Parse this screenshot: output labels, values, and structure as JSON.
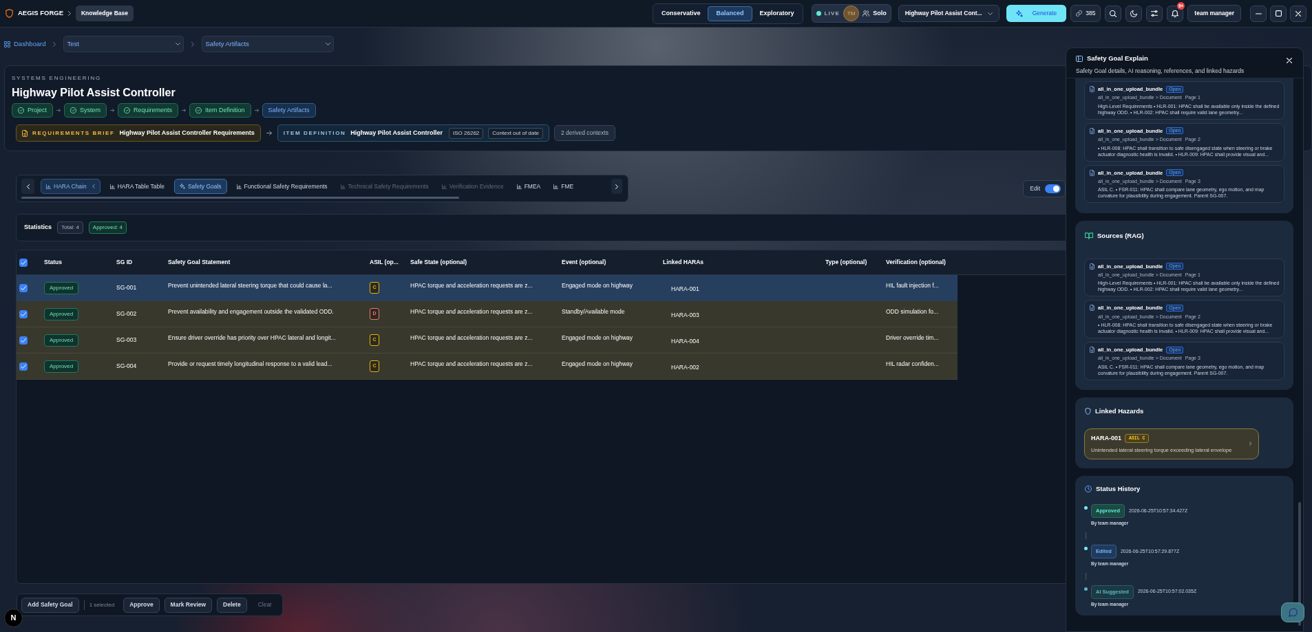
{
  "header": {
    "app_name": "AEGIS FORGE",
    "section": "Knowledge Base",
    "modes": [
      {
        "label": "Conservative",
        "selected": false
      },
      {
        "label": "Balanced",
        "selected": true
      },
      {
        "label": "Exploratory",
        "selected": false
      }
    ],
    "live": {
      "label": "LIVE",
      "avatar": "TM",
      "presence": "Solo"
    },
    "project": "Highway Pilot Assist Cont...",
    "generate": "Generate",
    "credits": "385",
    "notifications": "9+",
    "user": "team manager"
  },
  "breadcrumb": {
    "home": "Dashboard",
    "selects": [
      "Test",
      "Safety Artifacts"
    ]
  },
  "context_card": {
    "eyebrow": "SYSTEMS ENGINEERING",
    "title": "Highway Pilot Assist Controller",
    "steps": [
      {
        "label": "Project",
        "done": true
      },
      {
        "label": "System",
        "done": true
      },
      {
        "label": "Requirements",
        "done": true
      },
      {
        "label": "Item Definition",
        "done": true
      },
      {
        "label": "Safety Artifacts",
        "done": false
      }
    ],
    "brief": {
      "label": "REQUIREMENTS BRIEF",
      "value": "Highway Pilot Assist Controller Requirements"
    },
    "item_definition": {
      "label": "ITEM DEFINITION",
      "value": "Highway Pilot Assist Controller",
      "tags": [
        "ISO 26262",
        "Context out of date"
      ]
    },
    "derived": "2 derived contexts"
  },
  "tabs": [
    {
      "label": "HARA Chain",
      "kind": "group",
      "selected": false,
      "disabled": false
    },
    {
      "label": "HARA Table Table",
      "kind": "tab",
      "selected": false,
      "disabled": false
    },
    {
      "label": "Safety Goals",
      "kind": "ai",
      "selected": true,
      "disabled": false
    },
    {
      "label": "Functional Safety Requirements",
      "kind": "tab",
      "selected": false,
      "disabled": false
    },
    {
      "label": "Technical Safety Requirements",
      "kind": "tab",
      "selected": false,
      "disabled": true
    },
    {
      "label": "Verification Evidence",
      "kind": "tab",
      "selected": false,
      "disabled": true
    },
    {
      "label": "FMEA",
      "kind": "tab",
      "selected": false,
      "disabled": false
    },
    {
      "label": "FME",
      "kind": "tab",
      "selected": false,
      "disabled": false
    }
  ],
  "edit_toggle": {
    "label": "Edit",
    "on": true
  },
  "statistics": {
    "label": "Statistics",
    "chips": [
      {
        "label": "Total: 4",
        "kind": "total"
      },
      {
        "label": "Approved: 4",
        "kind": "approved"
      }
    ]
  },
  "table": {
    "all_checked": true,
    "columns": [
      "Status",
      "SG ID",
      "Safety Goal Statement",
      "ASIL (op...",
      "Safe State (optional)",
      "Event (optional)",
      "Linked HARAs",
      "Type (optional)",
      "Verification (optional)"
    ],
    "rows": [
      {
        "checked": true,
        "selected": true,
        "status": "Approved",
        "sg_id": "SG-001",
        "statement": "Prevent unintended lateral steering torque that could cause la...",
        "asil": {
          "label": "C",
          "color": "#eab308"
        },
        "safe_state": "HPAC torque and acceleration requests are z...",
        "event": "Engaged mode on highway",
        "linked_hara": "HARA-001",
        "verification": "HIL fault injection f..."
      },
      {
        "checked": true,
        "selected": false,
        "status": "Approved",
        "sg_id": "SG-002",
        "statement": "Prevent availability and engagement outside the validated ODD.",
        "asil": {
          "label": "D",
          "color": "#f87171"
        },
        "safe_state": "HPAC torque and acceleration requests are z...",
        "event": "Standby/Available mode",
        "linked_hara": "HARA-003",
        "verification": "ODD simulation fo..."
      },
      {
        "checked": true,
        "selected": false,
        "status": "Approved",
        "sg_id": "SG-003",
        "statement": "Ensure driver override has priority over HPAC lateral and longit...",
        "asil": {
          "label": "C",
          "color": "#eab308"
        },
        "safe_state": "HPAC torque and acceleration requests are z...",
        "event": "Engaged mode on highway",
        "linked_hara": "HARA-004",
        "verification": "Driver override tim..."
      },
      {
        "checked": true,
        "selected": false,
        "status": "Approved",
        "sg_id": "SG-004",
        "statement": "Provide or request timely longitudinal response to a valid lead...",
        "asil": {
          "label": "C",
          "color": "#eab308"
        },
        "safe_state": "HPAC torque and acceleration requests are z...",
        "event": "Engaged mode on highway",
        "linked_hara": "HARA-002",
        "verification": "HIL radar confiden..."
      }
    ]
  },
  "bulk_bar": {
    "add": "Add Safety Goal",
    "selection": "1 selected",
    "actions": [
      {
        "label": "Approve",
        "kind": "outline"
      },
      {
        "label": "Mark Review",
        "kind": "outline"
      },
      {
        "label": "Delete",
        "kind": "outline"
      },
      {
        "label": "Clear",
        "kind": "ghost"
      }
    ]
  },
  "dev_badge": "N",
  "explain_panel": {
    "title": "Safety Goal Explain",
    "subtitle": "Safety Goal details, AI reasoning, references, and linked hazards",
    "references": [
      {
        "name": "all_in_one_upload_bundle",
        "action": "Open",
        "path": "all_in_one_upload_bundle > Document",
        "page": "Page 1",
        "snippet": "High-Level Requirements • HLR-001: HPAC shall be available only inside the defined highway ODD. • HLR-002: HPAC shall require valid lane geometry..."
      },
      {
        "name": "all_in_one_upload_bundle",
        "action": "Open",
        "path": "all_in_one_upload_bundle > Document",
        "page": "Page 2",
        "snippet": "• HLR-008: HPAC shall transition to safe disengaged state when steering or brake actuator diagnostic health is invalid. • HLR-009: HPAC shall provide visual and..."
      },
      {
        "name": "all_in_one_upload_bundle",
        "action": "Open",
        "path": "all_in_one_upload_bundle > Document",
        "page": "Page 3",
        "snippet": "ASIL C. • FSR-011: HPAC shall compare lane geometry, ego motion, and map curvature for plausibility during engagement. Parent SG-007."
      }
    ],
    "sources": {
      "title": "Sources (RAG)",
      "items": [
        {
          "name": "all_in_one_upload_bundle",
          "action": "Open",
          "path": "all_in_one_upload_bundle > Document",
          "page": "Page 1",
          "snippet": "High-Level Requirements • HLR-001: HPAC shall be available only inside the defined highway ODD. • HLR-002: HPAC shall require valid lane geometry..."
        },
        {
          "name": "all_in_one_upload_bundle",
          "action": "Open",
          "path": "all_in_one_upload_bundle > Document",
          "page": "Page 2",
          "snippet": "• HLR-008: HPAC shall transition to safe disengaged state when steering or brake actuator diagnostic health is invalid. • HLR-009: HPAC shall provide visual and..."
        },
        {
          "name": "all_in_one_upload_bundle",
          "action": "Open",
          "path": "all_in_one_upload_bundle > Document",
          "page": "Page 3",
          "snippet": "ASIL C. • FSR-011: HPAC shall compare lane geometry, ego motion, and map curvature for plausibility during engagement. Parent SG-007."
        }
      ]
    },
    "linked_hazards": {
      "title": "Linked Hazards",
      "items": [
        {
          "id": "HARA-001",
          "asil": "ASIL C",
          "description": "Unintended lateral steering torque exceeding lateral envelope"
        }
      ]
    },
    "status_history": {
      "title": "Status History",
      "entries": [
        {
          "status": "Approved",
          "kind": "approved",
          "time": "2026-06-25T10:57:34.427Z",
          "by": "By team manager"
        },
        {
          "status": "Edited",
          "kind": "edited",
          "time": "2026-06-25T10:57:29.877Z",
          "by": "By team manager"
        },
        {
          "status": "AI Suggested",
          "kind": "suggested",
          "time": "2026-06-25T10:57:02.035Z",
          "by": "By team manager"
        }
      ]
    }
  }
}
